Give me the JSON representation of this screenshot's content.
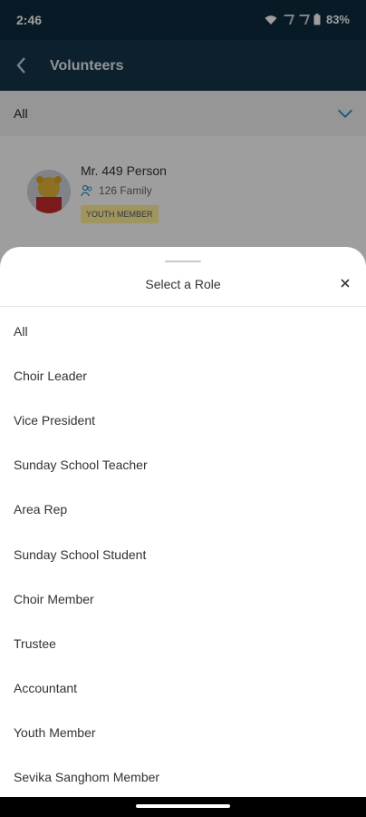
{
  "status_bar": {
    "time": "2:46",
    "battery": "83%"
  },
  "app_bar": {
    "title": "Volunteers",
    "back_icon": "chevron-left-icon"
  },
  "filter": {
    "selected": "All",
    "icon": "chevron-down-icon"
  },
  "card": {
    "name": "Mr. 449 Person",
    "family": "126 Family",
    "badge": "YOUTH MEMBER"
  },
  "sheet": {
    "title": "Select a Role",
    "close_icon": "close-icon",
    "options": [
      "All",
      "Choir Leader",
      "Vice President",
      "Sunday School Teacher",
      "Area Rep",
      "Sunday School Student",
      "Choir Member",
      "Trustee",
      "Accountant",
      "Youth Member",
      "Sevika Sanghom Member"
    ]
  },
  "colors": {
    "header": "#15344a",
    "accent": "#2b8fbf",
    "badge": "#fff099"
  }
}
